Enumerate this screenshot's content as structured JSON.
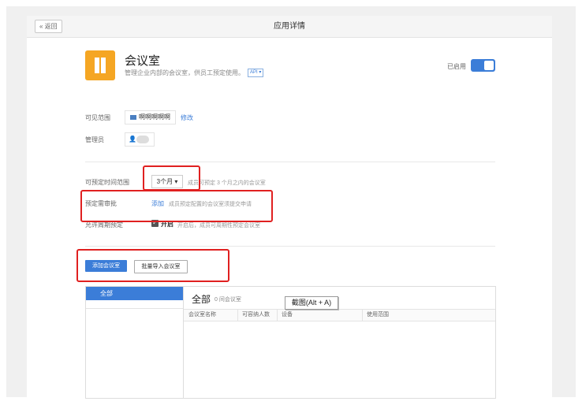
{
  "header": {
    "back_label": "« 返回",
    "title": "应用详情"
  },
  "app": {
    "name": "会议室",
    "description": "管理企业内部的会议室，供员工预定使用。",
    "api_badge": "API ▾",
    "status_label": "已启用",
    "enabled": true,
    "icon_color": "#f5a623"
  },
  "visibility": {
    "label": "可见范围",
    "tag": "啊啊啊啊啊",
    "edit_link": "修改"
  },
  "admins": {
    "label": "管理员"
  },
  "booking_range": {
    "label": "可预定时间范围",
    "selected": "3个月 ▾",
    "hint": "成员可预定 3 个月之内的会议室"
  },
  "approval": {
    "label": "预定需审批",
    "add_link": "添加",
    "hint": "成员预定配置的会议室须提交申请"
  },
  "periodic": {
    "label": "允许周期预定",
    "checked": true,
    "checkbox_label": "开启",
    "hint": "开启后，成员可周期性预定会议室"
  },
  "actions": {
    "add_room": "添加会议室",
    "batch_import": "批量导入会议室"
  },
  "rooms_panel": {
    "left_items": [
      "全部"
    ],
    "title": "全部",
    "count": "0 间会议室",
    "columns": [
      "会议室名称",
      "可容纳人数",
      "设备",
      "使用范围"
    ]
  },
  "tooltip": {
    "text": "截图(Alt + A)"
  },
  "colors": {
    "accent": "#3b7dd8",
    "annotation": "#e02020"
  }
}
